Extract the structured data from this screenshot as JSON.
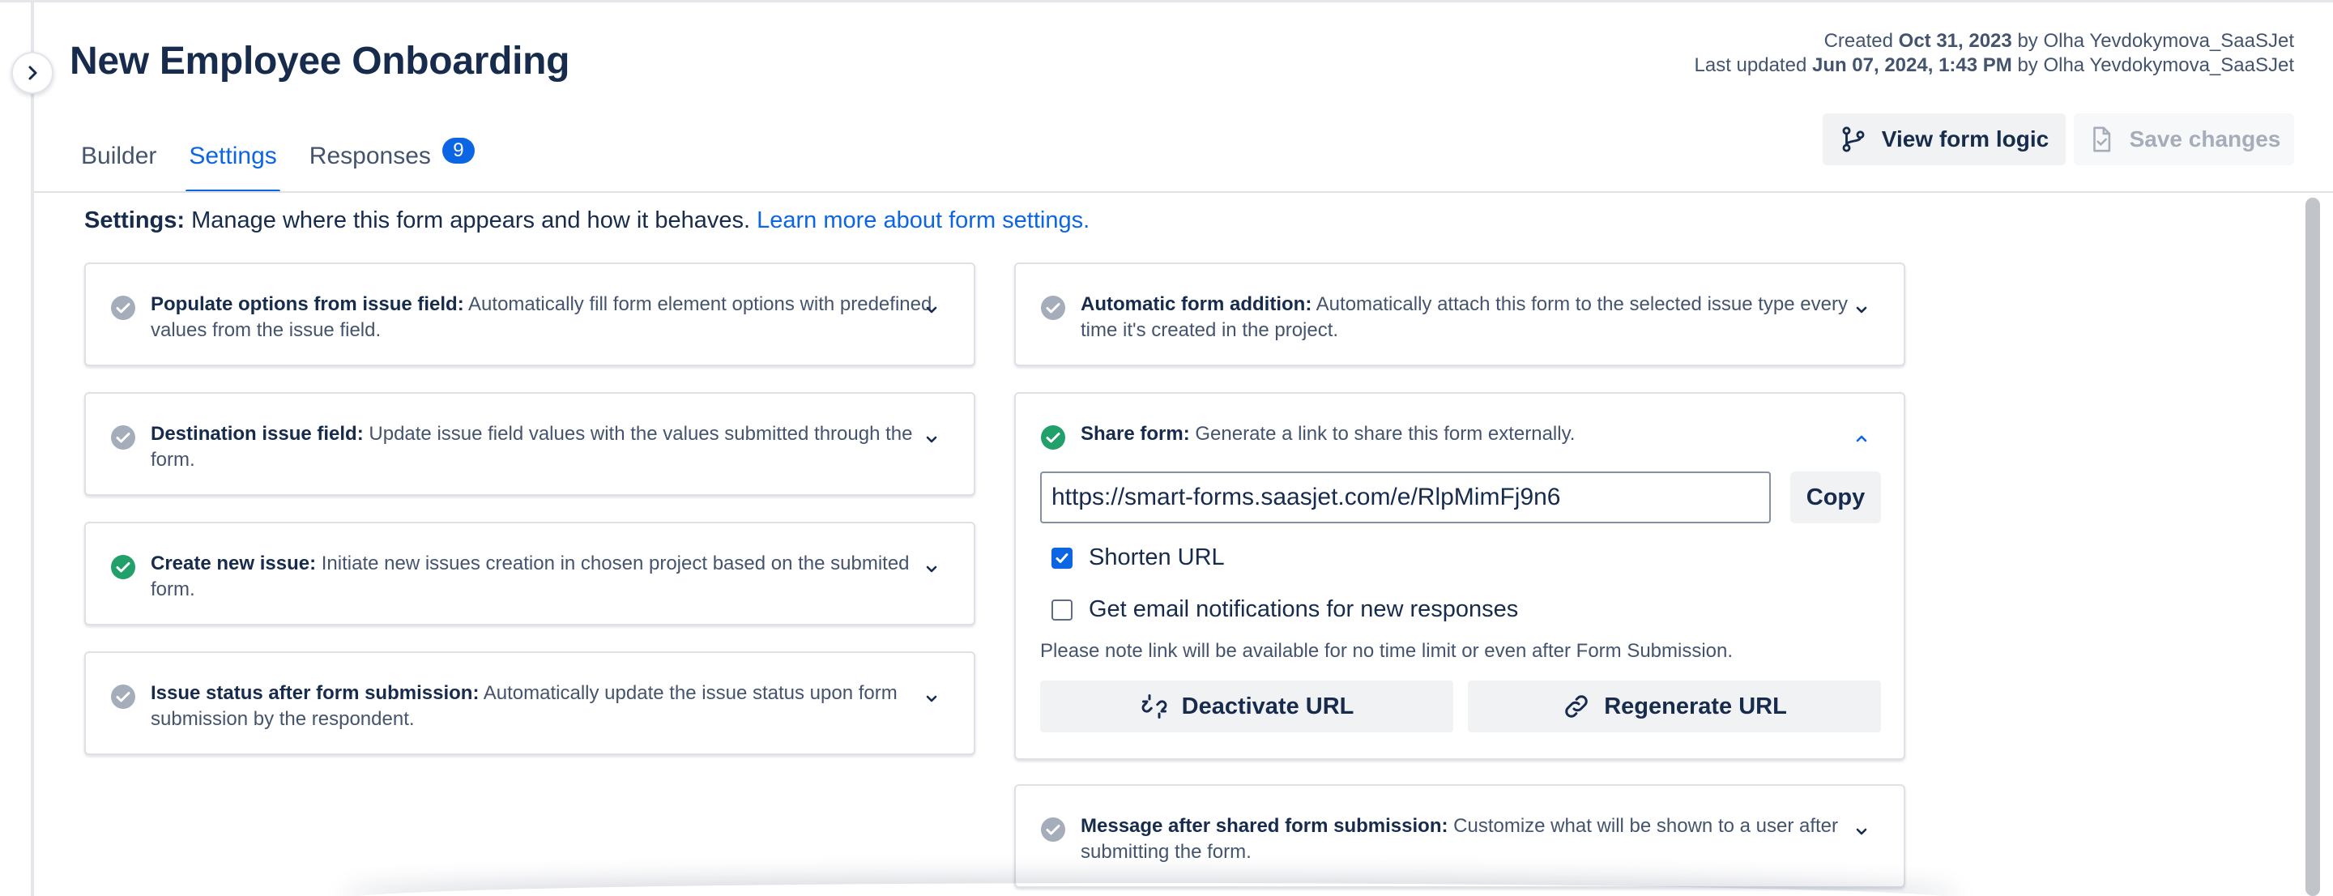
{
  "header": {
    "title": "New Employee Onboarding",
    "created_prefix": "Created",
    "created_date": "Oct 31, 2023",
    "created_by": "by Olha Yevdokymova_SaaSJet",
    "updated_prefix": "Last updated",
    "updated_date": "Jun 07, 2024, 1:43 PM",
    "updated_by": "by Olha Yevdokymova_SaaSJet"
  },
  "tabs": [
    {
      "label": "Builder"
    },
    {
      "label": "Settings"
    },
    {
      "label": "Responses",
      "badge": "9"
    }
  ],
  "toolbar": {
    "view_logic_label": "View form logic",
    "save_label": "Save changes"
  },
  "intro": {
    "label": "Settings:",
    "text": " Manage where this form appears and how it behaves. ",
    "link": "Learn more about form settings."
  },
  "left_cards": [
    {
      "title": "Populate options from issue field:",
      "desc": " Automatically fill form element options with predefined values from the issue field.",
      "status": "inactive"
    },
    {
      "title": "Destination issue field:",
      "desc": " Update issue field values with the values submitted through the form.",
      "status": "inactive"
    },
    {
      "title": "Create new issue:",
      "desc": " Initiate new issues creation in chosen project based on the submited form.",
      "status": "active"
    },
    {
      "title": "Issue status after form submission:",
      "desc": " Automatically update the issue status upon form submission by the respondent.",
      "status": "inactive"
    }
  ],
  "right_cards": {
    "auto_addition": {
      "title": "Automatic form addition:",
      "desc": " Automatically attach this form to the selected issue type every time it's created in the project.",
      "status": "inactive"
    },
    "share": {
      "title": "Share form:",
      "desc": " Generate a link to share this form externally.",
      "status": "active",
      "url": "https://smart-forms.saasjet.com/e/RlpMimFj9n6",
      "copy_label": "Copy",
      "shorten_label": "Shorten URL",
      "shorten_checked": true,
      "notify_label": "Get email notifications for new responses",
      "notify_checked": false,
      "note": "Please note link will be available for no time limit or even after Form Submission.",
      "deactivate_label": "Deactivate URL",
      "regenerate_label": "Regenerate URL"
    },
    "message_after": {
      "title": "Message after shared form submission:",
      "desc": " Customize what will be shown to a user after submitting the form.",
      "status": "inactive"
    }
  },
  "colors": {
    "accent": "#0c66e4",
    "active_status": "#22a06b",
    "inactive_status": "#a5adba"
  }
}
